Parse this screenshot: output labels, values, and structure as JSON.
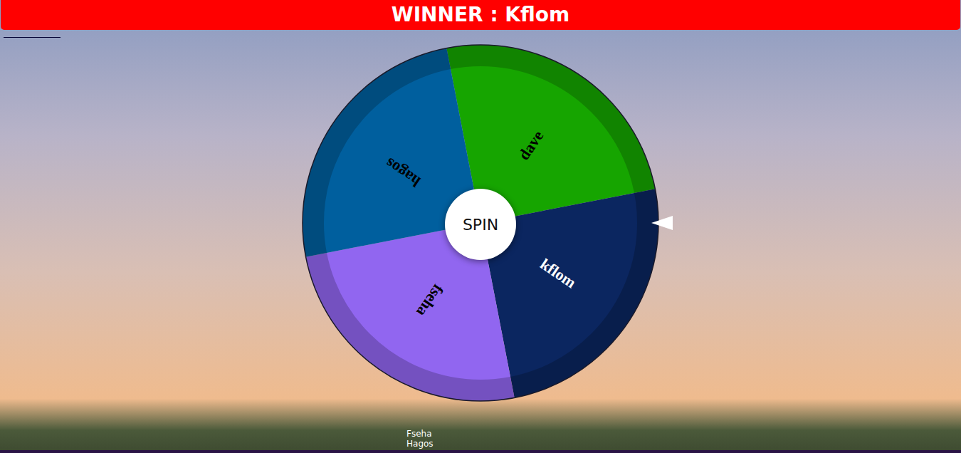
{
  "header": {
    "winner": "WINNER : Kflom"
  },
  "wheel": {
    "segments": [
      {
        "name": "dave",
        "color": "#16a500",
        "text_color": "#000000"
      },
      {
        "name": "kflom",
        "color": "#0b2660",
        "text_color": "#ffffff"
      },
      {
        "name": "fseha",
        "color": "#9166f0",
        "text_color": "#000000"
      },
      {
        "name": "hagos",
        "color": "#005f9e",
        "text_color": "#000000"
      }
    ]
  },
  "spin_button": {
    "label": "SPIN"
  },
  "names_list": [
    "Fseha",
    "Hagos"
  ]
}
